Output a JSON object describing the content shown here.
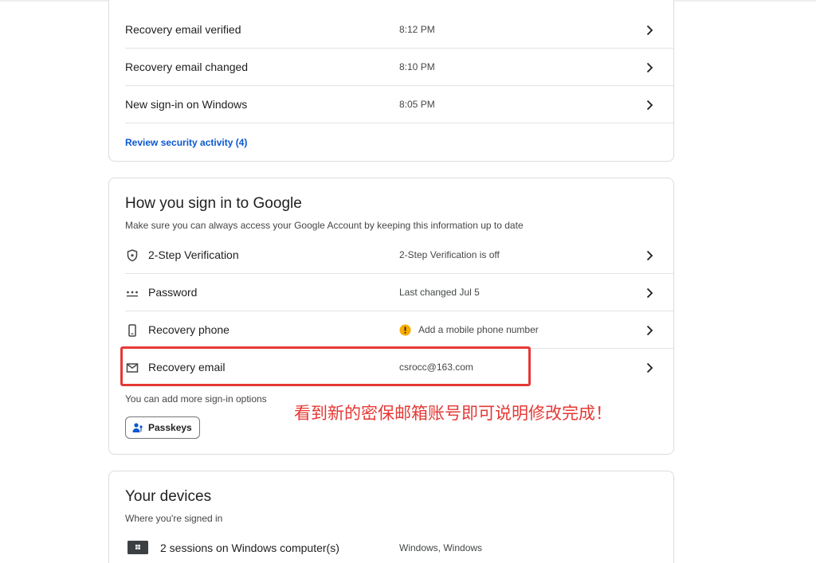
{
  "activity": {
    "rows": [
      {
        "label": "Recovery email verified",
        "time": "8:12 PM"
      },
      {
        "label": "Recovery email changed",
        "time": "8:10 PM"
      },
      {
        "label": "New sign-in on Windows",
        "time": "8:05 PM"
      }
    ],
    "review_link": "Review security activity (4)"
  },
  "signin": {
    "title": "How you sign in to Google",
    "subtitle": "Make sure you can always access your Google Account by keeping this information up to date",
    "rows": [
      {
        "icon": "shield-icon",
        "label": "2-Step Verification",
        "value": "2-Step Verification is off"
      },
      {
        "icon": "password-dots-icon",
        "label": "Password",
        "value": "Last changed Jul 5"
      },
      {
        "icon": "phone-icon",
        "label": "Recovery phone",
        "value": "Add a mobile phone number",
        "value_icon": "warning-icon"
      },
      {
        "icon": "mail-icon",
        "label": "Recovery email",
        "value": "csrocc@163.com"
      }
    ],
    "more_options": "You can add more sign-in options",
    "passkeys_label": "Passkeys"
  },
  "devices": {
    "title": "Your devices",
    "subtitle": "Where you're signed in",
    "rows": [
      {
        "icon": "laptop-icon",
        "label": "2 sessions on Windows computer(s)",
        "value": "Windows, Windows"
      }
    ]
  },
  "annotation": {
    "text": "看到新的密保邮箱账号即可说明修改完成！",
    "color": "#e53935"
  },
  "colors": {
    "link": "#0b57d0",
    "warning": "#f9ab00",
    "border": "#dadce0"
  }
}
